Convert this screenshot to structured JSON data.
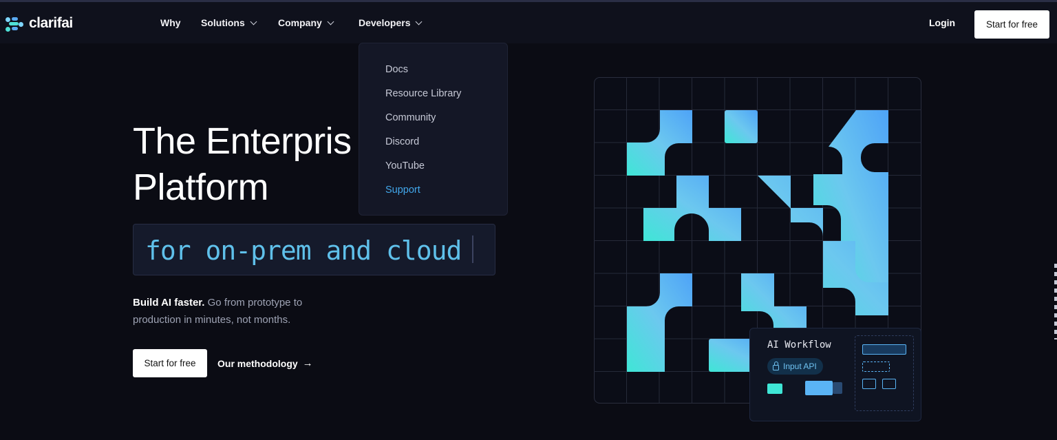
{
  "brand": {
    "name": "clarifai",
    "accent": "#42a8ec"
  },
  "nav": {
    "items": [
      {
        "label": "Why",
        "has_dropdown": false
      },
      {
        "label": "Solutions",
        "has_dropdown": true
      },
      {
        "label": "Company",
        "has_dropdown": true
      },
      {
        "label": "Developers",
        "has_dropdown": true
      }
    ],
    "login_label": "Login",
    "cta_label": "Start for free"
  },
  "dropdown": {
    "items": [
      "Docs",
      "Resource Library",
      "Community",
      "Discord",
      "YouTube",
      "Support"
    ],
    "active_item": "Support"
  },
  "hero": {
    "title_line1": "The Enterpris",
    "title_line2": "Platform",
    "typed_text": "for on-prem and cloud",
    "subtext_bold": "Build AI faster.",
    "subtext_rest": " Go from prototype to production in minutes, not months.",
    "cta_primary": "Start for free",
    "cta_secondary": "Our methodology"
  },
  "workflow_card": {
    "title": "AI Workflow",
    "pill_label": "Input API"
  },
  "icons": {
    "chevron": "chevron-down-icon",
    "arrow": "arrow-right-icon",
    "lock": "lock-icon"
  }
}
